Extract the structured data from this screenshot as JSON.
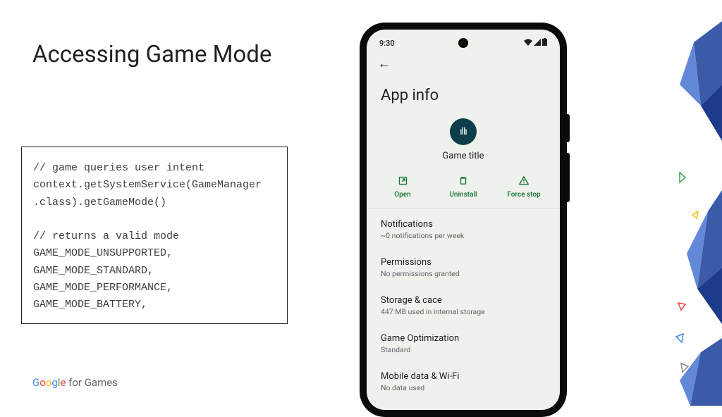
{
  "slide": {
    "title": "Accessing Game Mode",
    "code": "// game queries user intent\ncontext.getSystemService(GameManager\n.class).getGameMode()\n\n// returns a valid mode\nGAME_MODE_UNSUPPORTED,\nGAME_MODE_STANDARD,\nGAME_MODE_PERFORMANCE,\nGAME_MODE_BATTERY,",
    "footer_for": " for Games"
  },
  "phone": {
    "time": "9:30",
    "page_title": "App info",
    "app_name": "Game title",
    "actions": {
      "open": "Open",
      "uninstall": "Uninstall",
      "forcestop": "Force stop"
    },
    "settings": [
      {
        "title": "Notifications",
        "sub": "~0 notifications per week"
      },
      {
        "title": "Permissions",
        "sub": "No permissions granted"
      },
      {
        "title": "Storage & cace",
        "sub": "447 MB used in internal storage"
      },
      {
        "title": "Game Optimization",
        "sub": "Standard"
      },
      {
        "title": "Mobile data & Wi-Fi",
        "sub": "No data used"
      }
    ]
  }
}
